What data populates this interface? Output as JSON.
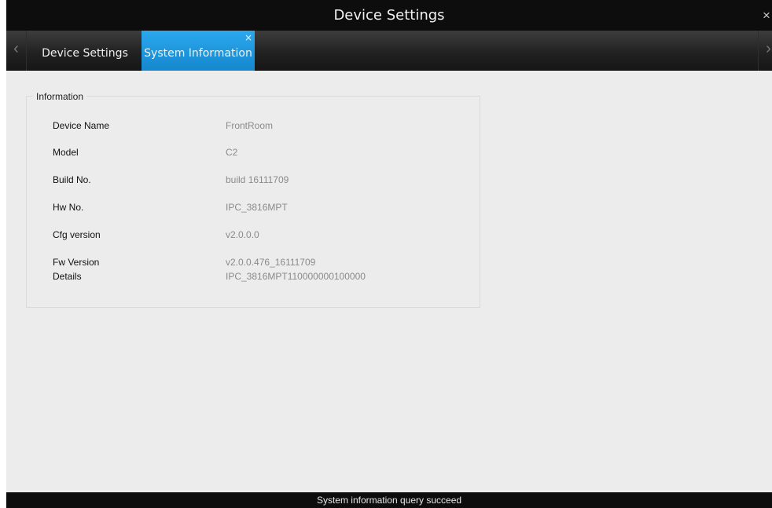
{
  "window": {
    "title": "Device Settings",
    "close_glyph": "×"
  },
  "tabs": {
    "left_arrow": "‹",
    "right_arrow": "›",
    "items": [
      {
        "label": "Device Settings"
      },
      {
        "label": "System Information",
        "close_glyph": "×"
      }
    ]
  },
  "info": {
    "legend": "Information",
    "rows": [
      {
        "label": "Device Name",
        "value": "FrontRoom"
      },
      {
        "label": "Model",
        "value": "C2"
      },
      {
        "label": "Build No.",
        "value": "build 16111709"
      },
      {
        "label": "Hw No.",
        "value": "IPC_3816MPT"
      },
      {
        "label": "Cfg version",
        "value": "v2.0.0.0"
      },
      {
        "label": "Fw Version",
        "value": "v2.0.0.476_16111709"
      },
      {
        "label": "Details",
        "value": "IPC_3816MPT110000000100000"
      }
    ]
  },
  "status": {
    "text": "System information query succeed"
  },
  "colors": {
    "title_bar": "#0d0d0d",
    "active_tab": "#1e96dc",
    "panel_bg": "#ececec",
    "value_text": "#8a8a8a"
  }
}
